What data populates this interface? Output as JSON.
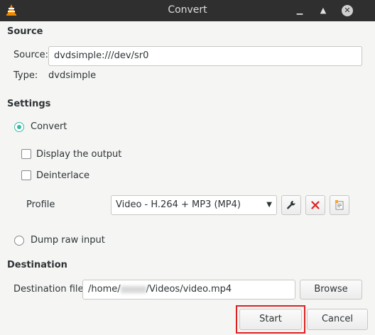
{
  "window": {
    "title": "Convert",
    "icons": [
      "vlc-cone-icon",
      "minimize-icon",
      "maximize-icon",
      "close-icon"
    ]
  },
  "source": {
    "heading": "Source",
    "source_label": "Source:",
    "source_value": "dvdsimple:///dev/sr0",
    "type_label": "Type:",
    "type_value": "dvdsimple"
  },
  "settings": {
    "heading": "Settings",
    "convert_label": "Convert",
    "convert_selected": true,
    "display_output_label": "Display the output",
    "display_output_checked": false,
    "deinterlace_label": "Deinterlace",
    "deinterlace_checked": false,
    "profile_label": "Profile",
    "profile_value": "Video - H.264 + MP3 (MP4)",
    "dump_raw_label": "Dump raw input",
    "dump_raw_selected": false
  },
  "destination": {
    "heading": "Destination",
    "file_label": "Destination file:",
    "file_value_prefix": "/home/",
    "file_value_suffix": "/Videos/video.mp4",
    "browse_label": "Browse"
  },
  "actions": {
    "start_label": "Start",
    "cancel_label": "Cancel"
  },
  "colors": {
    "titlebar": "#2f2f2f",
    "accent": "#3db7a5",
    "delete_red": "#e02020",
    "highlight": "#e02020"
  }
}
